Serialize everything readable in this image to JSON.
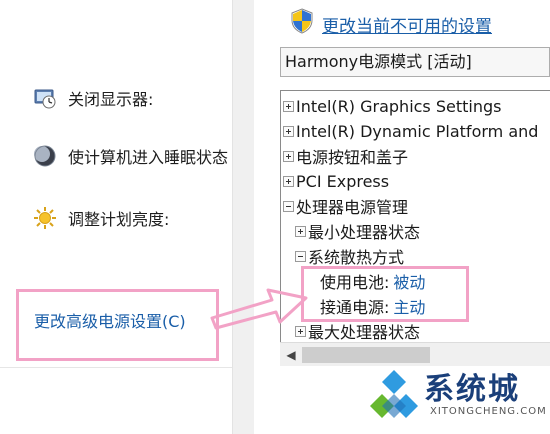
{
  "left_pane": {
    "items": [
      {
        "label": "关闭显示器:",
        "icon": "monitor-clock-icon"
      },
      {
        "label": "使计算机进入睡眠状态",
        "icon": "moon-icon"
      },
      {
        "label": "调整计划亮度:",
        "icon": "sun-icon"
      }
    ],
    "advanced_link": "更改高级电源设置(C)"
  },
  "dialog": {
    "change_settings_link": "更改当前不可用的设置",
    "plan_select": "Harmony电源模式 [活动]",
    "tree": {
      "n0": "Intel(R) Graphics Settings",
      "n1": "Intel(R) Dynamic Platform and",
      "n2": "电源按钮和盖子",
      "n3": "PCI Express",
      "n4": "处理器电源管理",
      "n5": "最小处理器状态",
      "n6": "系统散热方式",
      "battery_label": "使用电池:",
      "battery_value": "被动",
      "plugged_label": "接通电源:",
      "plugged_value": "主动",
      "n9": "最大处理器状态"
    }
  },
  "watermark": {
    "title": "系统城",
    "subtitle": "XITONGCHENG.COM"
  },
  "colors": {
    "link": "#1a5ea8",
    "highlight": "#f2a2c6",
    "watermark_text": "#1a3f7a"
  }
}
